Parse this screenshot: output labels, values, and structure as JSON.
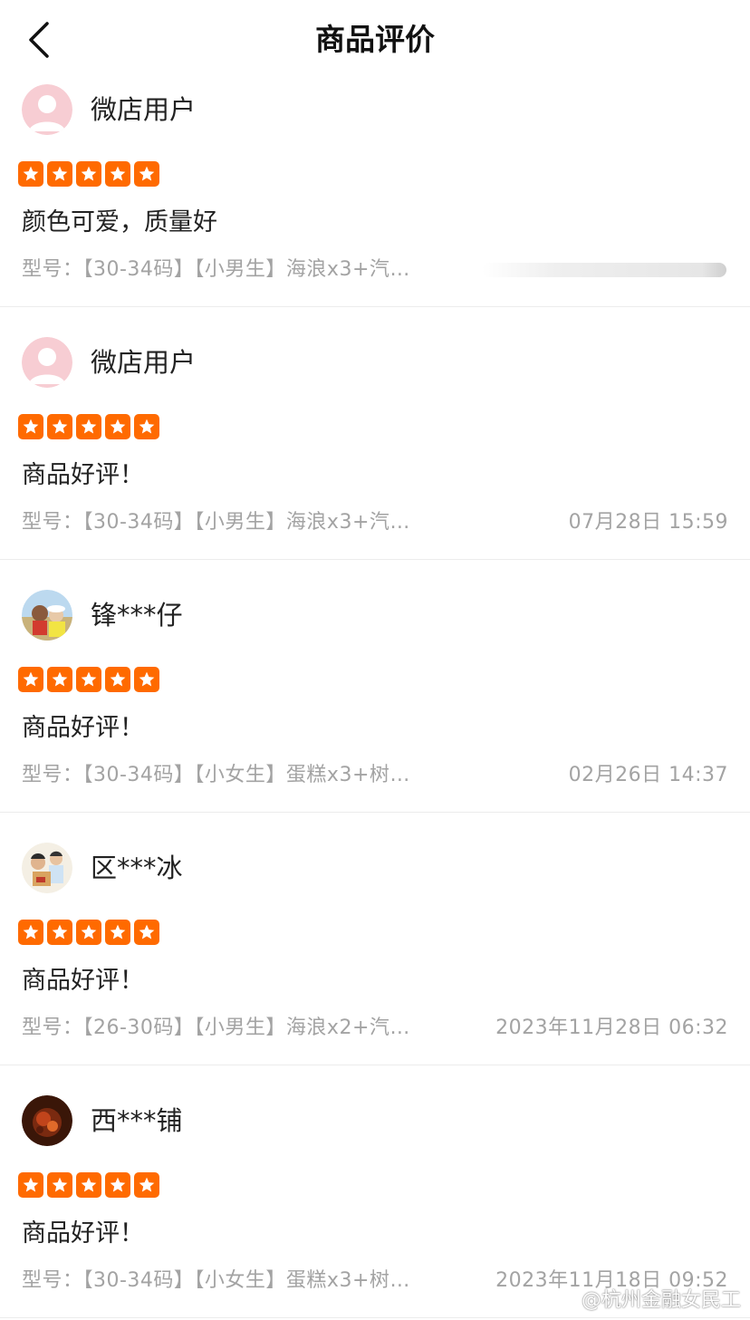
{
  "header": {
    "title": "商品评价"
  },
  "colors": {
    "star": "#ff6a00",
    "meta_text": "#a3a3a3"
  },
  "reviews": [
    {
      "username": "微店用户",
      "avatar": "default-pink-avatar",
      "rating": 5,
      "content": "颜色可爱，质量好",
      "spec": "型号：【30-34码】【小男生】海浪x3+汽…",
      "time": ""
    },
    {
      "username": "微店用户",
      "avatar": "default-pink-avatar",
      "rating": 5,
      "content": "商品好评！",
      "spec": "型号：【30-34码】【小男生】海浪x3+汽…",
      "time": "07月28日 15:59"
    },
    {
      "username": "锋***仔",
      "avatar": "photo-avatar",
      "rating": 5,
      "content": "商品好评！",
      "spec": "型号：【30-34码】【小女生】蛋糕x3+树…",
      "time": "02月26日 14:37"
    },
    {
      "username": "区***冰",
      "avatar": "photo-avatar",
      "rating": 5,
      "content": "商品好评！",
      "spec": "型号：【26-30码】【小男生】海浪x2+汽…",
      "time": "2023年11月28日 06:32"
    },
    {
      "username": "西***铺",
      "avatar": "photo-avatar",
      "rating": 5,
      "content": "商品好评！",
      "spec": "型号：【30-34码】【小女生】蛋糕x3+树…",
      "time": "2023年11月18日 09:52"
    }
  ],
  "watermark": "@杭州金融女民工"
}
